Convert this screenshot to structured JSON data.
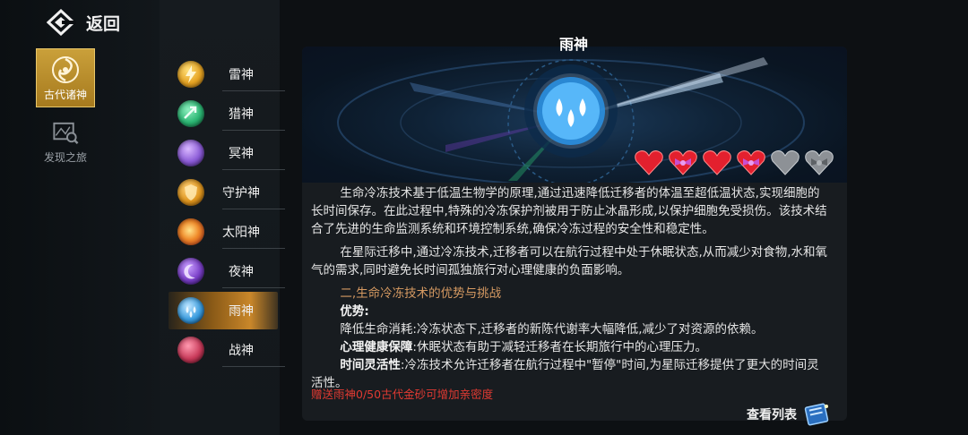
{
  "nav": {
    "back_label": "返回"
  },
  "side_tabs": [
    {
      "label": "古代诸神",
      "active": true
    },
    {
      "label": "发现之旅",
      "active": false
    }
  ],
  "gods": [
    {
      "name": "雷神",
      "color": "#e6a322"
    },
    {
      "name": "猎神",
      "color": "#2bb673"
    },
    {
      "name": "冥神",
      "color": "#8a5ad6"
    },
    {
      "name": "守护神",
      "color": "#e0961e"
    },
    {
      "name": "太阳神",
      "color": "#e8502a"
    },
    {
      "name": "夜神",
      "color": "#7a3fc8"
    },
    {
      "name": "雨神",
      "color": "#3a9de0"
    },
    {
      "name": "战神",
      "color": "#c93a5a"
    }
  ],
  "selected_god": "雨神",
  "detail": {
    "title": "雨神",
    "affinity_hearts": [
      "red",
      "ribbon",
      "red",
      "ribbon",
      "gray",
      "gray-ribbon"
    ],
    "para1": "生命冷冻技术基于低温生物学的原理,通过迅速降低迁移者的体温至超低温状态,实现细胞的长时间保存。在此过程中,特殊的冷冻保护剂被用于防止冰晶形成,以保护细胞免受损伤。该技术结合了先进的生命监测系统和环境控制系统,确保冷冻过程的安全性和稳定性。",
    "para2": "在星际迁移中,通过冷冻技术,迁移者可以在航行过程中处于休眠状态,从而减少对食物,水和氧气的需求,同时避免长时间孤独旅行对心理健康的负面影响。",
    "section_title": "二,生命冷冻技术的优势与挑战",
    "advantages_label": "优势:",
    "line1": "降低生命消耗:冷冻状态下,迁移者的新陈代谢率大幅降低,减少了对资源的依赖。",
    "line2_label": "心理健康保障",
    "line2_text": ":休眠状态有助于减轻迁移者在长期旅行中的心理压力。",
    "line3_label": "时间灵活性",
    "line3_text": ":冷冻技术允许迁移者在航行过程中\"暂停\"时间,为星际迁移提供了更大的时间灵活性。",
    "gift_text": "赠送雨神0/50古代金砂可增加亲密度",
    "view_list_label": "查看列表"
  },
  "colors": {
    "accent_gold": "#c9872a",
    "section_orange": "#d69a62",
    "gift_red": "#e03a32"
  }
}
